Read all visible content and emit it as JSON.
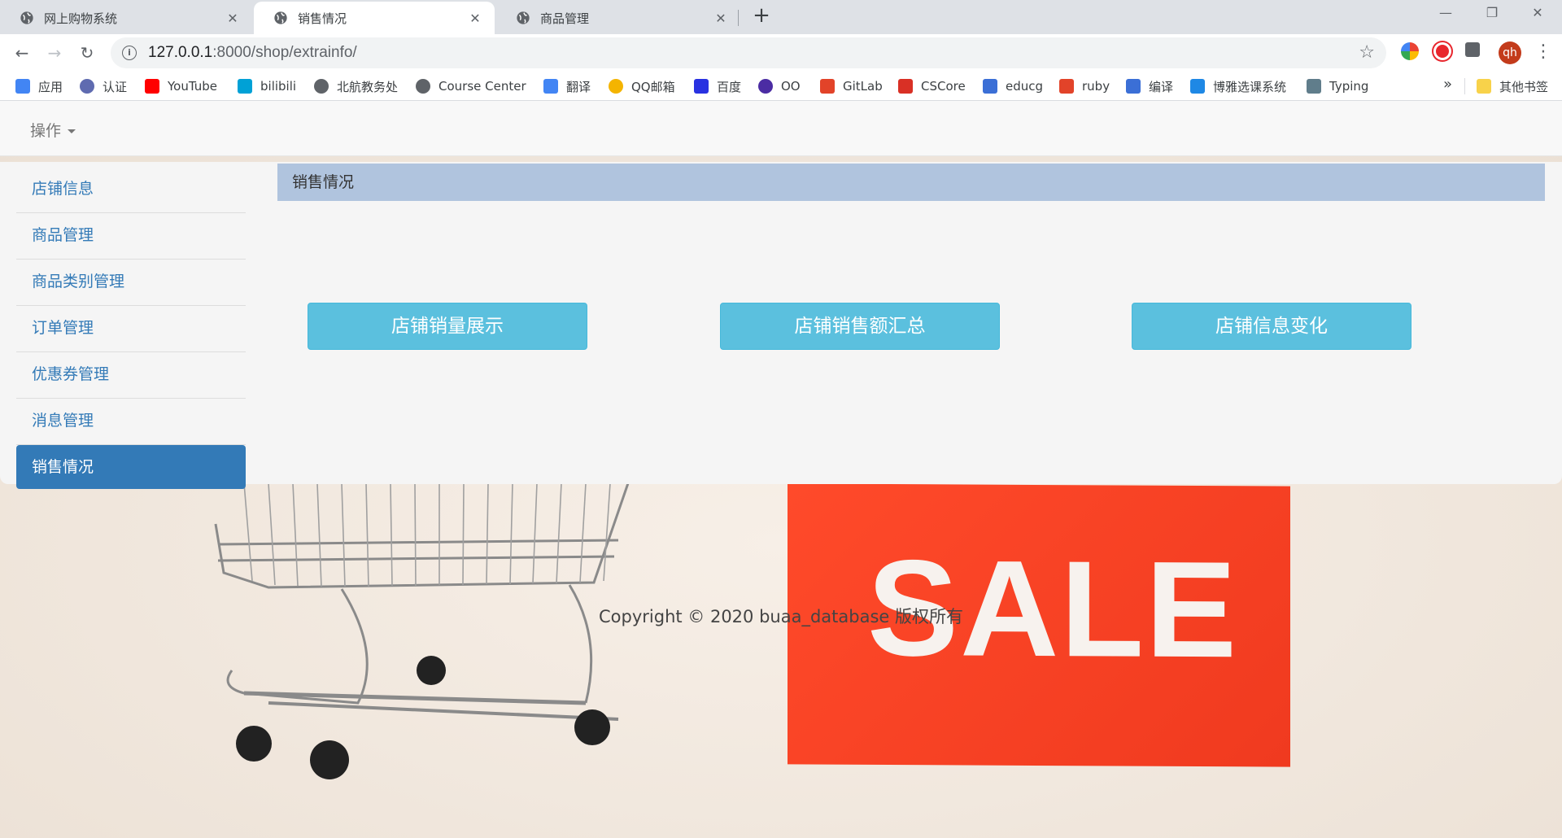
{
  "browser": {
    "tabs": [
      {
        "title": "网上购物系统",
        "active": false
      },
      {
        "title": "销售情况",
        "active": true
      },
      {
        "title": "商品管理",
        "active": false
      }
    ],
    "close_glyph": "✕",
    "new_tab_glyph": "+",
    "url_host": "127.0.0.1",
    "url_path": ":8000/shop/extrainfo/",
    "avatar_text": "qh",
    "bookmarks": [
      {
        "label": "应用",
        "icon": "apps-grid-icon",
        "color": "#4285f4"
      },
      {
        "label": "认证",
        "icon": "auth-icon",
        "color": "#5f6bb0"
      },
      {
        "label": "YouTube",
        "icon": "youtube-icon",
        "color": "#ff0000"
      },
      {
        "label": "bilibili",
        "icon": "bilibili-icon",
        "color": "#00a1d6"
      },
      {
        "label": "北航教务处",
        "icon": "globe-icon",
        "color": "#5f6368"
      },
      {
        "label": "Course Center",
        "icon": "globe-icon",
        "color": "#5f6368"
      },
      {
        "label": "翻译",
        "icon": "translate-icon",
        "color": "#4285f4"
      },
      {
        "label": "QQ邮箱",
        "icon": "qqmail-icon",
        "color": "#f4b400"
      },
      {
        "label": "百度",
        "icon": "baidu-icon",
        "color": "#2932e1"
      },
      {
        "label": "OO",
        "icon": "hexagon-icon",
        "color": "#4b2ca3"
      },
      {
        "label": "GitLab",
        "icon": "gitlab-icon",
        "color": "#e24329"
      },
      {
        "label": "CSCore",
        "icon": "cscore-icon",
        "color": "#d93025"
      },
      {
        "label": "educg",
        "icon": "educg-icon",
        "color": "#3b6fd6"
      },
      {
        "label": "ruby",
        "icon": "gitlab-icon",
        "color": "#e24329"
      },
      {
        "label": "编译",
        "icon": "educg-icon",
        "color": "#3b6fd6"
      },
      {
        "label": "博雅选课系统",
        "icon": "book-icon",
        "color": "#1e88e5"
      },
      {
        "label": "Typing",
        "icon": "typing-icon",
        "color": "#607d8b"
      }
    ],
    "bookmarks_overflow": "»",
    "other_bookmarks": "其他书签"
  },
  "navbar": {
    "dropdown_label": "操作"
  },
  "sidebar": {
    "items": [
      {
        "label": "店铺信息",
        "active": false
      },
      {
        "label": "商品管理",
        "active": false
      },
      {
        "label": "商品类别管理",
        "active": false
      },
      {
        "label": "订单管理",
        "active": false
      },
      {
        "label": "优惠券管理",
        "active": false
      },
      {
        "label": "消息管理",
        "active": false
      },
      {
        "label": "销售情况",
        "active": true
      }
    ]
  },
  "content": {
    "header": "销售情况",
    "buttons": [
      "店铺销量展示",
      "店铺销售额汇总",
      "店铺信息变化"
    ]
  },
  "background": {
    "sale_text": "SALE",
    "tag_color": "#f2401f"
  },
  "footer": {
    "copyright": "Copyright © 2020  buaa_database 版权所有"
  }
}
